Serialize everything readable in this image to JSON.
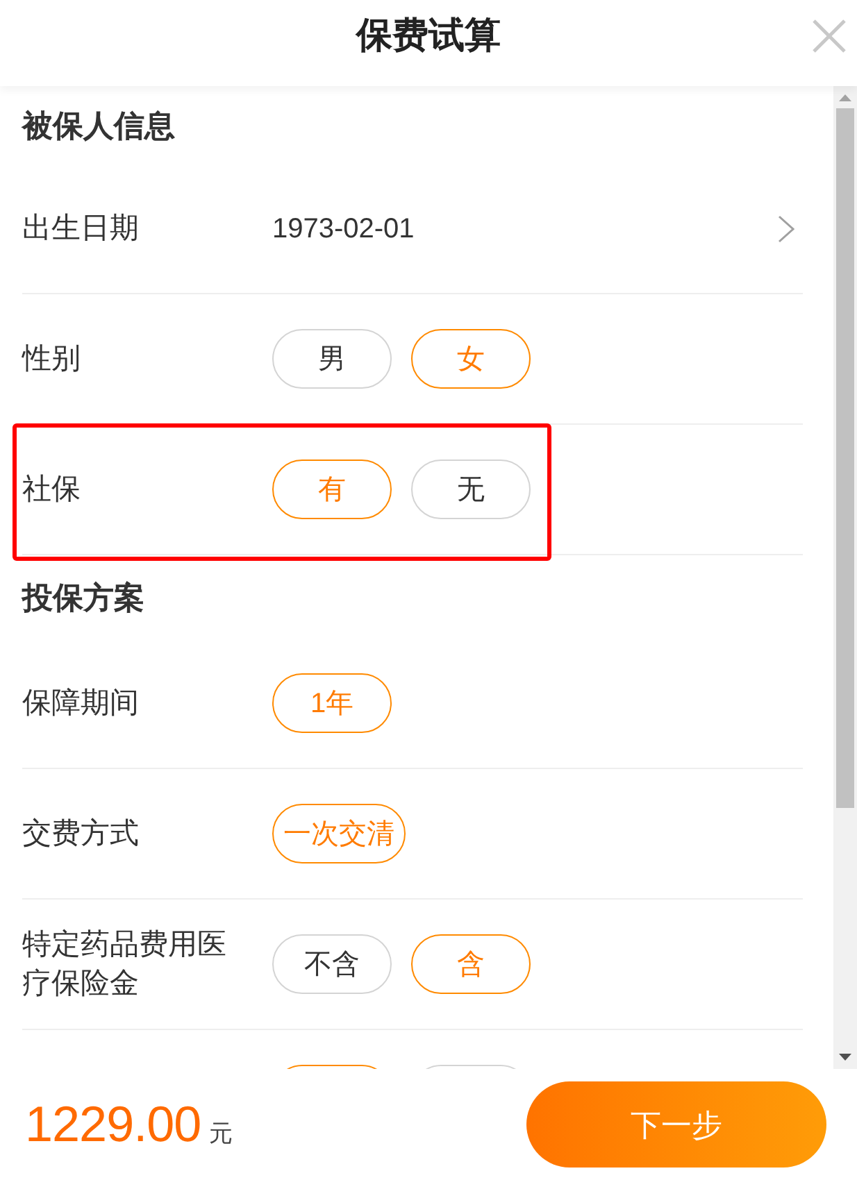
{
  "header": {
    "title": "保费试算"
  },
  "sections": [
    {
      "title": "被保人信息",
      "rows": [
        {
          "kind": "value",
          "label": "出生日期",
          "value": "1973-02-01",
          "highlighted": false
        },
        {
          "kind": "choice",
          "label": "性别",
          "highlighted": false,
          "options": [
            {
              "label": "男",
              "selected": false
            },
            {
              "label": "女",
              "selected": true
            }
          ]
        },
        {
          "kind": "choice",
          "label": "社保",
          "highlighted": true,
          "options": [
            {
              "label": "有",
              "selected": true
            },
            {
              "label": "无",
              "selected": false
            }
          ]
        }
      ]
    },
    {
      "title": "投保方案",
      "rows": [
        {
          "kind": "choice",
          "label": "保障期间",
          "highlighted": false,
          "options": [
            {
              "label": "1年",
              "selected": true
            }
          ]
        },
        {
          "kind": "choice",
          "label": "交费方式",
          "highlighted": false,
          "options": [
            {
              "label": "一次交清",
              "selected": true
            }
          ]
        },
        {
          "kind": "choice",
          "label": "特定药品费用医疗保险金",
          "highlighted": false,
          "options": [
            {
              "label": "不含",
              "selected": false
            },
            {
              "label": "含",
              "selected": true
            }
          ]
        }
      ],
      "partial_row": {
        "options": [
          {
            "selected": true
          },
          {
            "selected": false
          }
        ]
      }
    }
  ],
  "footer": {
    "price": "1229.00",
    "unit": "元",
    "button": "下一步"
  }
}
